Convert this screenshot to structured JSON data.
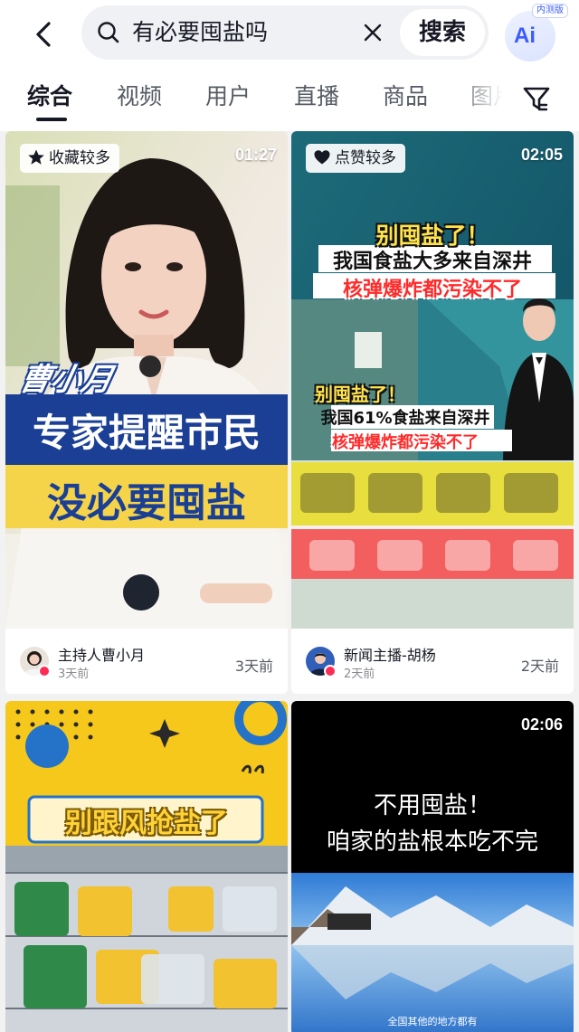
{
  "header": {
    "search_query": "有必要囤盐吗",
    "search_button": "搜索",
    "ai_label": "Ai",
    "ai_badge": "内测版"
  },
  "tabs": [
    "综合",
    "视频",
    "用户",
    "直播",
    "商品",
    "图片"
  ],
  "cards": [
    {
      "tag": "收藏较多",
      "tag_icon": "star-icon",
      "duration": "01:27",
      "overlay": [
        "曹小月",
        "专家提醒市民",
        "没必要囤盐"
      ],
      "author": "主持人曹小月",
      "posted": "3天前",
      "ago": "3天前"
    },
    {
      "tag": "点赞较多",
      "tag_icon": "heart-icon",
      "duration": "02:05",
      "overlay": [
        "别囤盐了！",
        "我国食盐大多来自深井",
        "核弹爆炸都污染不了",
        "别囤盐了！",
        "我国61%食盐来自深井",
        "核弹爆炸都污染不了"
      ],
      "author": "新闻主播-胡杨",
      "posted": "2天前",
      "ago": "2天前"
    },
    {
      "overlay": [
        "别跟风抢盐了"
      ]
    },
    {
      "duration": "02:06",
      "overlay": [
        "不用囤盐！",
        "咱家的盐根本吃不完",
        "全国其他的地方都有"
      ]
    }
  ],
  "colors": {
    "accent": "#fe2c55",
    "text_primary": "#161823",
    "ai_blue": "#3b5bff"
  }
}
